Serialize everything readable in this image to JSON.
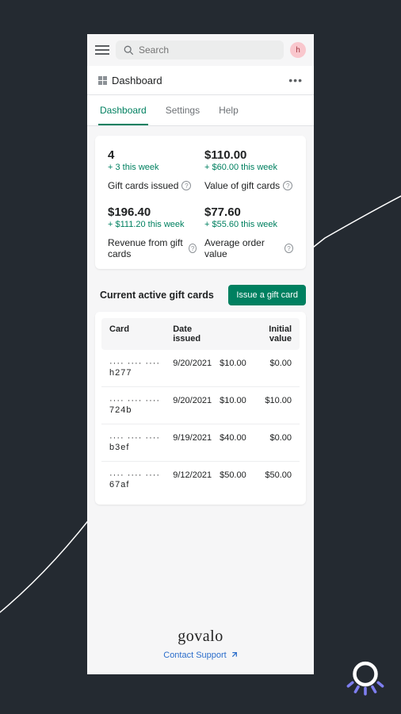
{
  "search": {
    "placeholder": "Search"
  },
  "avatar": "h",
  "page_title": "Dashboard",
  "tabs": [
    {
      "label": "Dashboard",
      "active": true
    },
    {
      "label": "Settings",
      "active": false
    },
    {
      "label": "Help",
      "active": false
    }
  ],
  "stats": [
    {
      "value": "4",
      "delta": "+ 3 this week",
      "label": "Gift cards issued"
    },
    {
      "value": "$110.00",
      "delta": "+ $60.00 this week",
      "label": "Value of gift cards"
    },
    {
      "value": "$196.40",
      "delta": "+ $111.20 this week",
      "label": "Revenue from gift cards"
    },
    {
      "value": "$77.60",
      "delta": "+ $55.60 this week",
      "label": "Average order value"
    }
  ],
  "section_title": "Current active gift cards",
  "issue_button": "Issue a gift card",
  "table": {
    "headers": [
      "Card",
      "Date issued",
      "",
      "Initial value"
    ],
    "rows": [
      {
        "card": "···· ···· ···· h277",
        "date": "9/20/2021",
        "amount": "$10.00",
        "initial": "$0.00"
      },
      {
        "card": "···· ···· ···· 724b",
        "date": "9/20/2021",
        "amount": "$10.00",
        "initial": "$10.00"
      },
      {
        "card": "···· ···· ···· b3ef",
        "date": "9/19/2021",
        "amount": "$40.00",
        "initial": "$0.00"
      },
      {
        "card": "···· ···· ···· 67af",
        "date": "9/12/2021",
        "amount": "$50.00",
        "initial": "$50.00"
      }
    ]
  },
  "brand": "govalo",
  "support_link": "Contact Support"
}
